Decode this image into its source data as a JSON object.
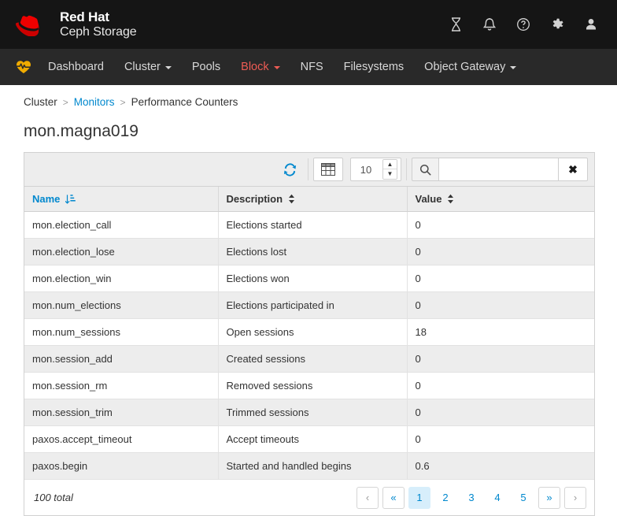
{
  "masthead": {
    "brand_line1": "Red Hat",
    "brand_line2": "Ceph Storage",
    "logo_icon": "red-hat-fedora-logo",
    "tools": [
      {
        "name": "tasks-icon",
        "glyph": "hourglass"
      },
      {
        "name": "notifications-icon",
        "glyph": "bell"
      },
      {
        "name": "help-icon",
        "glyph": "question-circle"
      },
      {
        "name": "settings-icon",
        "glyph": "gear"
      },
      {
        "name": "user-icon",
        "glyph": "user"
      }
    ]
  },
  "nav": {
    "brand_icon": "heartbeat-icon",
    "items": [
      {
        "label": "Dashboard",
        "caret": false,
        "active": false
      },
      {
        "label": "Cluster",
        "caret": true,
        "active": false
      },
      {
        "label": "Pools",
        "caret": false,
        "active": false
      },
      {
        "label": "Block",
        "caret": true,
        "active": true
      },
      {
        "label": "NFS",
        "caret": false,
        "active": false
      },
      {
        "label": "Filesystems",
        "caret": false,
        "active": false
      },
      {
        "label": "Object Gateway",
        "caret": true,
        "active": false
      }
    ],
    "active_color": "#ee5c54"
  },
  "breadcrumb": {
    "items": [
      {
        "label": "Cluster",
        "link": false
      },
      {
        "label": "Monitors",
        "link": true
      },
      {
        "label": "Performance Counters",
        "link": false
      }
    ],
    "separator": ">",
    "link_color": "#0088ce"
  },
  "page": {
    "title": "mon.magna019"
  },
  "toolbar": {
    "refresh_icon": "refresh-icon",
    "columns_icon": "table-columns-icon",
    "page_size": "10",
    "spinner_up_icon": "chevron-up-icon",
    "spinner_down_icon": "chevron-down-icon",
    "search_icon": "search-icon",
    "search_value": "",
    "search_placeholder": "",
    "clear_icon": "close-icon",
    "clear_label": "✖"
  },
  "table": {
    "columns": [
      {
        "label": "Name",
        "sorted": true,
        "sort_dir": "asc"
      },
      {
        "label": "Description",
        "sorted": false,
        "sort_dir": "none"
      },
      {
        "label": "Value",
        "sorted": false,
        "sort_dir": "none"
      }
    ],
    "rows": [
      {
        "name": "mon.election_call",
        "description": "Elections started",
        "value": "0"
      },
      {
        "name": "mon.election_lose",
        "description": "Elections lost",
        "value": "0"
      },
      {
        "name": "mon.election_win",
        "description": "Elections won",
        "value": "0"
      },
      {
        "name": "mon.num_elections",
        "description": "Elections participated in",
        "value": "0"
      },
      {
        "name": "mon.num_sessions",
        "description": "Open sessions",
        "value": "18"
      },
      {
        "name": "mon.session_add",
        "description": "Created sessions",
        "value": "0"
      },
      {
        "name": "mon.session_rm",
        "description": "Removed sessions",
        "value": "0"
      },
      {
        "name": "mon.session_trim",
        "description": "Trimmed sessions",
        "value": "0"
      },
      {
        "name": "paxos.accept_timeout",
        "description": "Accept timeouts",
        "value": "0"
      },
      {
        "name": "paxos.begin",
        "description": "Started and handled begins",
        "value": "0.6"
      }
    ]
  },
  "footer": {
    "total_label": "100 total",
    "pager": [
      {
        "label": "‹",
        "name": "pager-prev",
        "style": "arrow"
      },
      {
        "label": "«",
        "name": "pager-first",
        "style": "dbl"
      },
      {
        "label": "1",
        "name": "pager-page-1",
        "style": "active"
      },
      {
        "label": "2",
        "name": "pager-page-2",
        "style": "num"
      },
      {
        "label": "3",
        "name": "pager-page-3",
        "style": "num"
      },
      {
        "label": "4",
        "name": "pager-page-4",
        "style": "num"
      },
      {
        "label": "5",
        "name": "pager-page-5",
        "style": "num"
      },
      {
        "label": "»",
        "name": "pager-last",
        "style": "dbl"
      },
      {
        "label": "›",
        "name": "pager-next",
        "style": "arrow"
      }
    ],
    "active_bg": "#d7eefb"
  }
}
